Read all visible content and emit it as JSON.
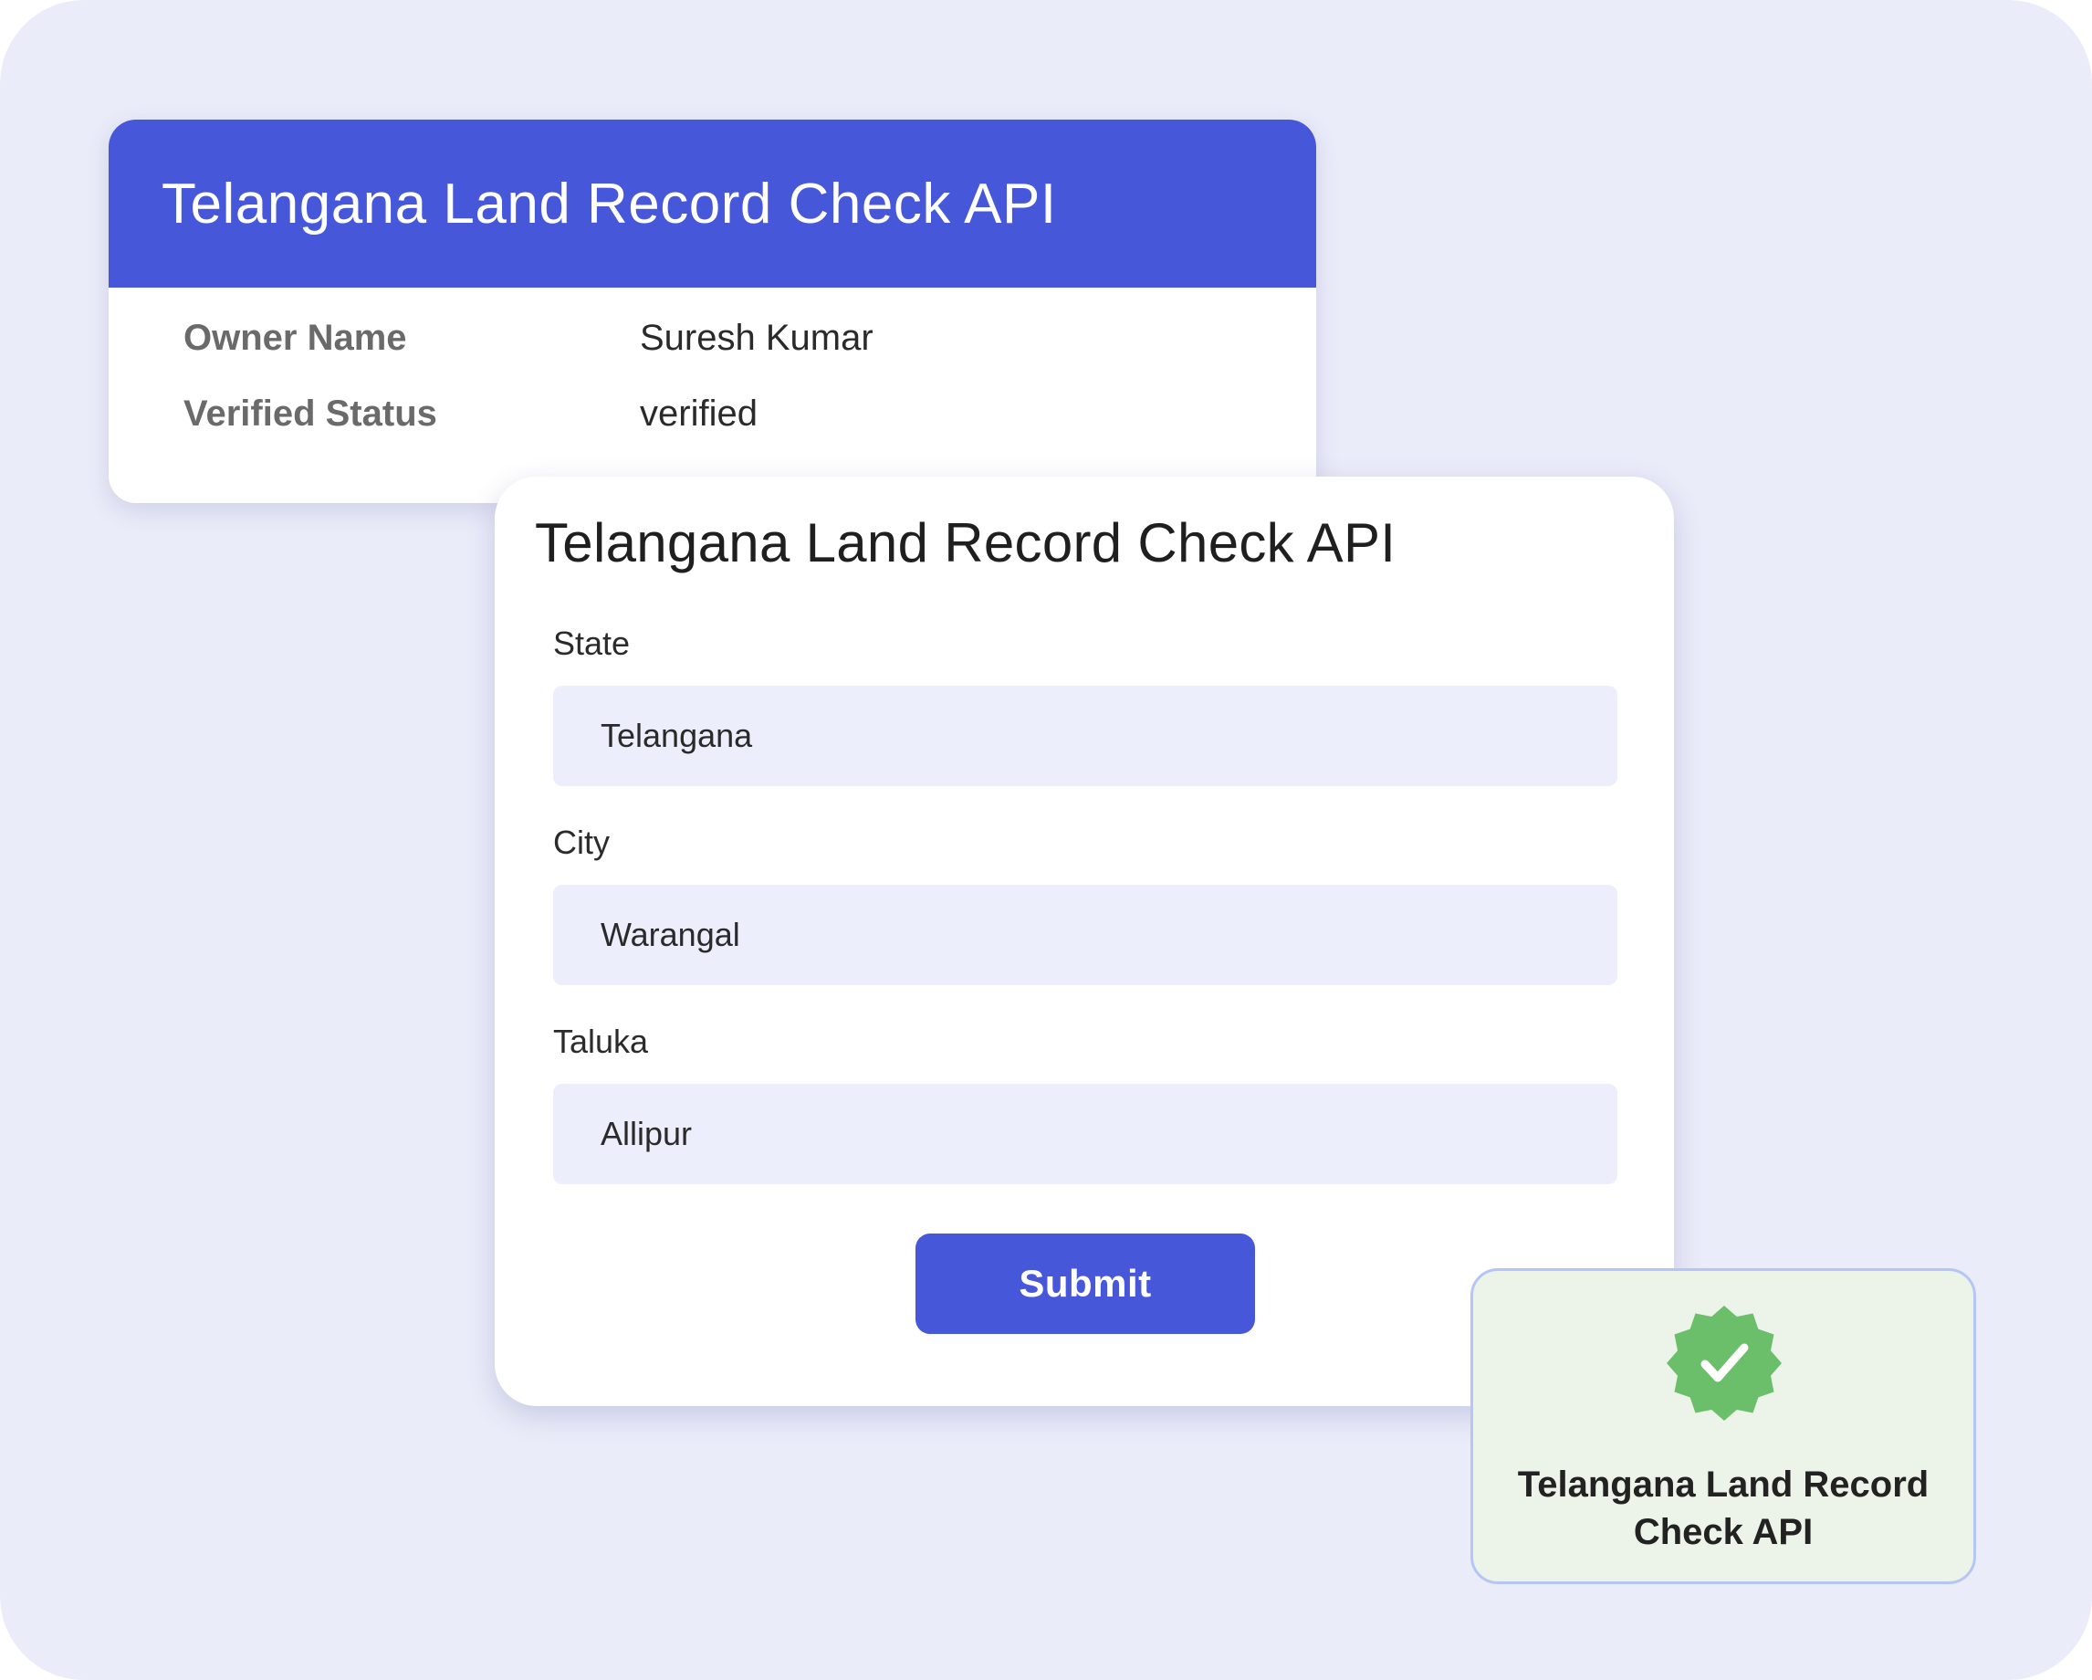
{
  "result_card": {
    "title": "Telangana Land Record Check API",
    "rows": [
      {
        "key": "Owner Name",
        "value": "Suresh Kumar"
      },
      {
        "key": "Verified Status",
        "value": "verified"
      }
    ]
  },
  "form": {
    "title": "Telangana Land Record Check API",
    "fields": [
      {
        "label": "State",
        "value": "Telangana"
      },
      {
        "label": "City",
        "value": "Warangal"
      },
      {
        "label": "Taluka",
        "value": "Allipur"
      }
    ],
    "submit_label": "Submit"
  },
  "badge": {
    "icon": "verified-check-icon",
    "line1": "Telangana Land Record",
    "line2": "Check API"
  },
  "colors": {
    "background": "#eaecf9",
    "accent": "#4658d9",
    "input_fill": "#eceefb",
    "badge_fill": "#ecf3e9",
    "badge_border": "#b5c6f4",
    "check_green": "#6cbf6a"
  }
}
